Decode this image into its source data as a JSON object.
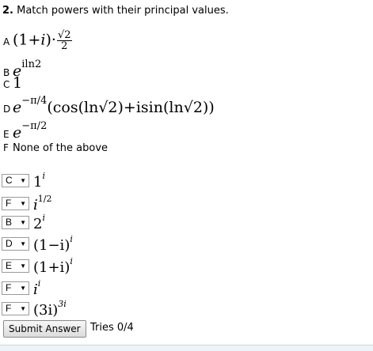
{
  "question": {
    "number": "2.",
    "text": "Match powers with their principal values."
  },
  "choices": [
    {
      "letter": "A",
      "expr_pre": "(1+",
      "expr_i": "i",
      "expr_mid": ")·",
      "frac_num": "√2",
      "frac_den": "2"
    },
    {
      "letter": "B",
      "base": "e",
      "sup": "iln2"
    },
    {
      "letter": "C",
      "value": "1"
    },
    {
      "letter": "D",
      "base": "e",
      "sup": "−π/4",
      "tail": "(cos(ln√2)+isin(ln√2))"
    },
    {
      "letter": "E",
      "base": "e",
      "sup": "−π/2"
    },
    {
      "letter": "F",
      "text": "None of the above"
    }
  ],
  "matches": [
    {
      "selected": "C",
      "base": "1",
      "sup": "i"
    },
    {
      "selected": "F",
      "base": "i",
      "sup": "1/2"
    },
    {
      "selected": "B",
      "base": "2",
      "sup": "i"
    },
    {
      "selected": "D",
      "base": "(1−i)",
      "sup": "i"
    },
    {
      "selected": "E",
      "base": "(1+i)",
      "sup": "i"
    },
    {
      "selected": "F",
      "base": "i",
      "sup": "i"
    },
    {
      "selected": "F",
      "base": "(3i)",
      "sup": "3i"
    }
  ],
  "submit_label": "Submit Answer",
  "tries": "Tries 0/4",
  "dropdown_arrow": "▼"
}
